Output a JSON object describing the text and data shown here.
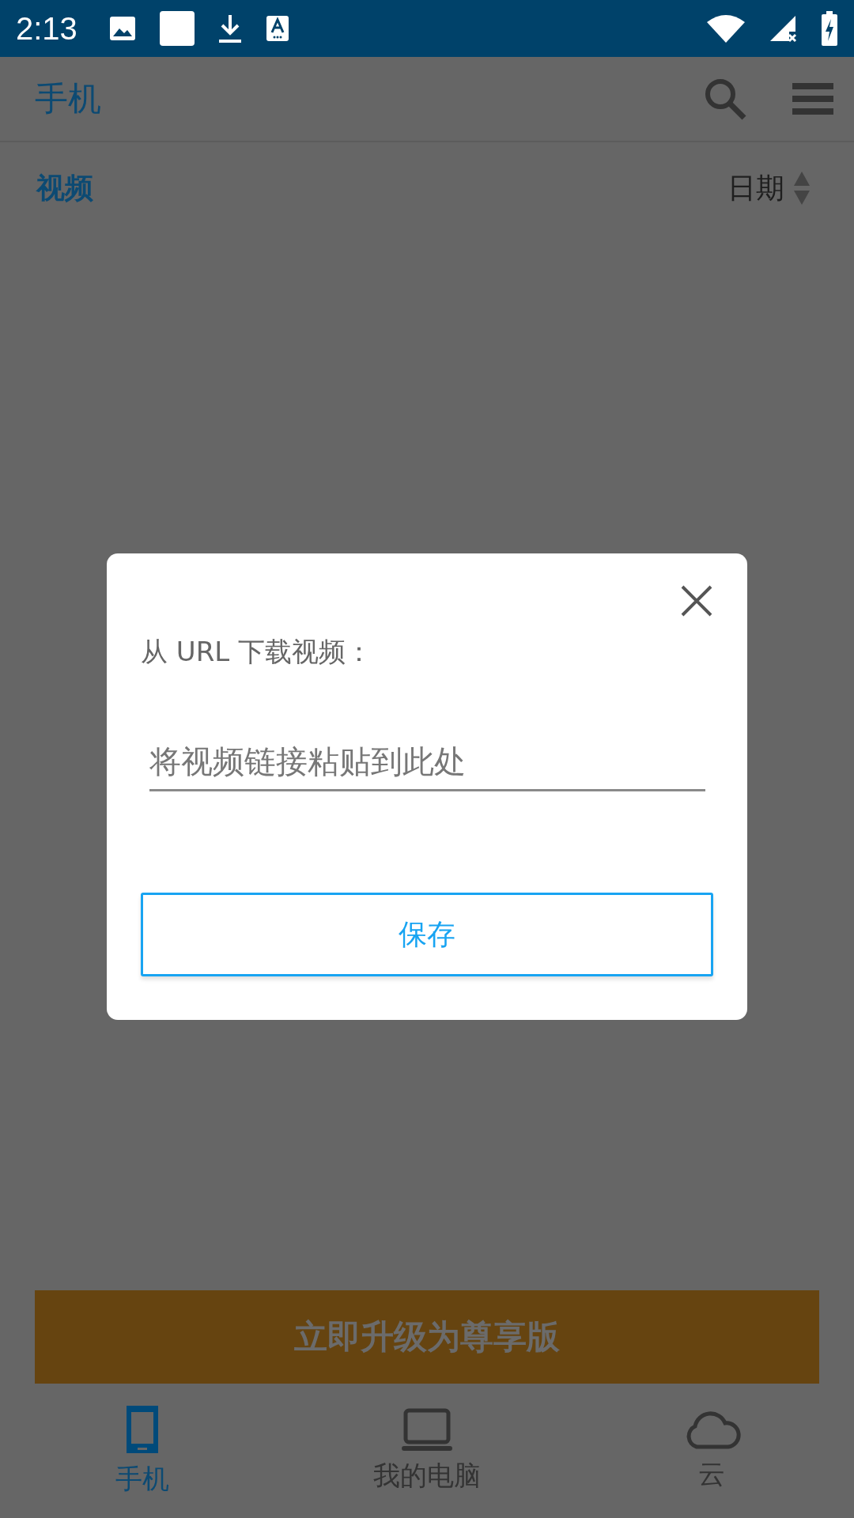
{
  "status_bar": {
    "time": "2:13"
  },
  "app_bar": {
    "title": "手机"
  },
  "list_header": {
    "section": "视频",
    "sort_label": "日期"
  },
  "banner": {
    "label": "立即升级为尊享版"
  },
  "bottom_nav": [
    {
      "label": "手机",
      "kind": "phone",
      "selected": true
    },
    {
      "label": "我的电脑",
      "kind": "laptop",
      "selected": false
    },
    {
      "label": "云",
      "kind": "cloud",
      "selected": false
    }
  ],
  "dialog": {
    "label": "从 URL 下载视频：",
    "placeholder": "将视频链接粘贴到此处",
    "button": "保存"
  }
}
